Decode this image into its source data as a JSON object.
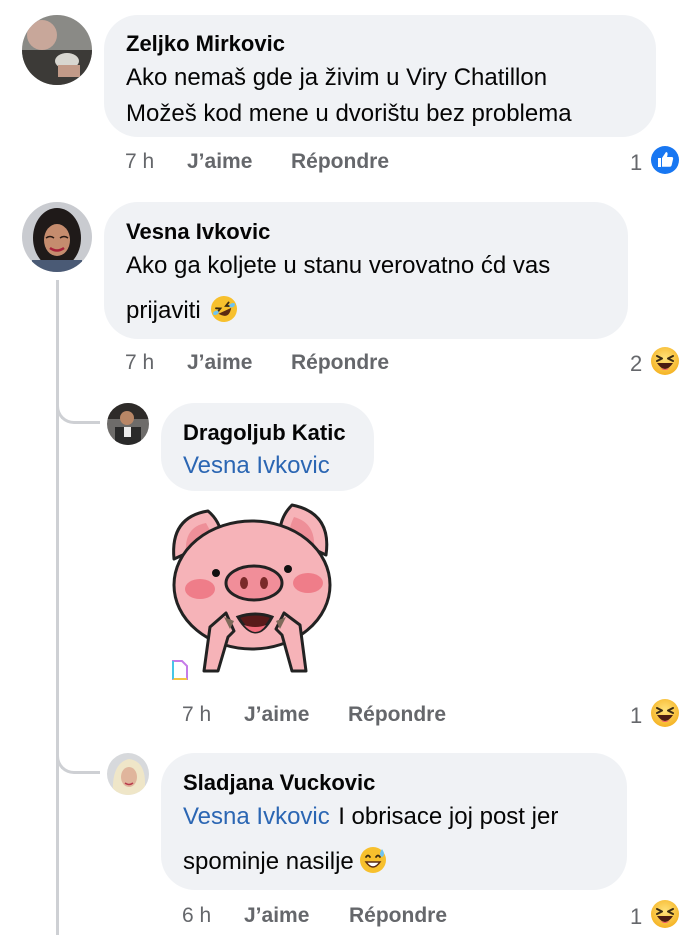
{
  "comments": [
    {
      "author": "Zeljko Mirkovic",
      "lines": [
        "Ako nemaš gde ja živim u Viry Chatillon",
        "Možeš kod mene u dvorištu bez problema"
      ],
      "time": "7 h",
      "like": "J’aime",
      "reply": "Répondre",
      "reaction_count": "1",
      "reaction_icon": "like-icon"
    },
    {
      "author": "Vesna Ivkovic",
      "lines": [
        "Ako ga koljete u stanu verovatno ćd vas",
        "prijaviti"
      ],
      "emoji": "rolling-laugh-emoji",
      "time": "7 h",
      "like": "J’aime",
      "reply": "Répondre",
      "reaction_count": "2",
      "reaction_icon": "haha-icon"
    }
  ],
  "replies": [
    {
      "author": "Dragoljub Katic",
      "mention": "Vesna Ivkovic",
      "sticker": "pig-sticker",
      "time": "7 h",
      "like": "J’aime",
      "reply": "Répondre",
      "reaction_count": "1",
      "reaction_icon": "haha-icon"
    },
    {
      "author": "Sladjana Vuckovic",
      "mention": "Vesna Ivkovic",
      "line1_rest": "I obrisace joj post jer",
      "line2": "spominje nasilje",
      "emoji": "sweat-smile-emoji",
      "time": "6 h",
      "like": "J’aime",
      "reply": "Répondre",
      "reaction_count": "1",
      "reaction_icon": "haha-icon"
    }
  ],
  "colors": {
    "bubble": "#f0f2f5",
    "mention": "#2b66b3",
    "meta": "#65676b",
    "like": "#1877f2",
    "haha": "#f7b125"
  }
}
